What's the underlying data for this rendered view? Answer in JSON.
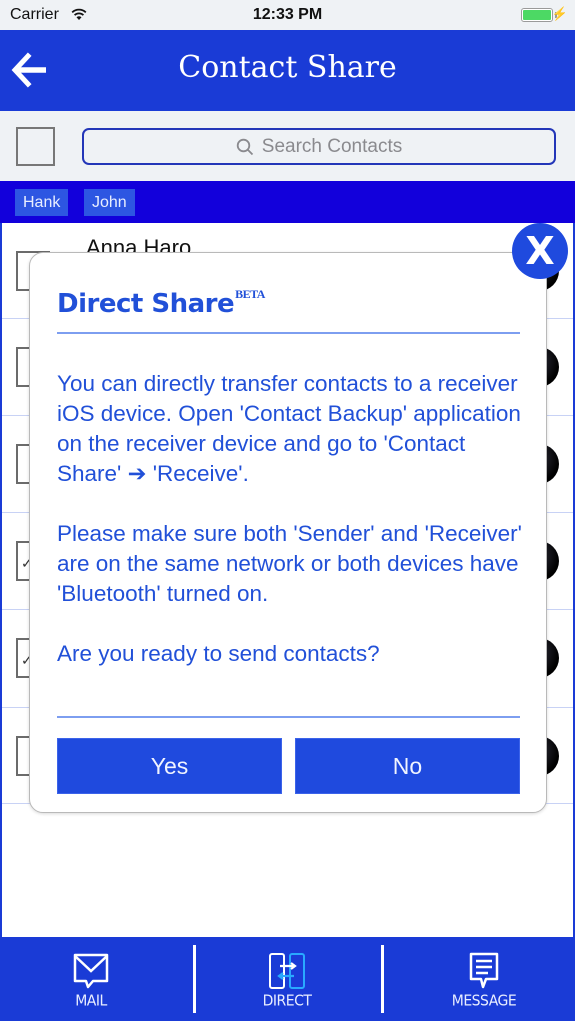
{
  "status_bar": {
    "carrier": "Carrier",
    "time": "12:33 PM",
    "battery_percent": 100,
    "charging": true
  },
  "nav": {
    "title": "Contact Share",
    "back_icon": "arrow-left-icon"
  },
  "search": {
    "placeholder": "Search Contacts",
    "select_all_checked": false
  },
  "chips": [
    {
      "label": "Hank"
    },
    {
      "label": "John"
    }
  ],
  "contacts": [
    {
      "name": "Anna Haro",
      "checked": false
    },
    {
      "name": "",
      "checked": false
    },
    {
      "name": "",
      "checked": false
    },
    {
      "name": "",
      "checked": true
    },
    {
      "name": "",
      "checked": true
    },
    {
      "name": "",
      "checked": false
    }
  ],
  "dialog": {
    "title": "Direct Share",
    "title_badge": "BETA",
    "paragraphs": [
      "You can directly transfer contacts to a receiver iOS device. Open 'Contact Backup' application on the receiver device and go to 'Contact Share' ➔ 'Receive'.",
      "Please make sure both 'Sender' and 'Receiver' are on the same network or both devices have 'Bluetooth' turned on.",
      "Are you ready to send contacts?"
    ],
    "yes_label": "Yes",
    "no_label": "No",
    "close_label": "X"
  },
  "toolbar": {
    "items": [
      {
        "label": "MAIL",
        "icon": "mail-icon"
      },
      {
        "label": "DIRECT",
        "icon": "direct-transfer-icon"
      },
      {
        "label": "MESSAGE",
        "icon": "message-icon"
      }
    ]
  },
  "colors": {
    "primary": "#1a3bd6",
    "chips_bar": "#1200db",
    "accent_text": "#2150d8",
    "button": "#1f4ade"
  }
}
